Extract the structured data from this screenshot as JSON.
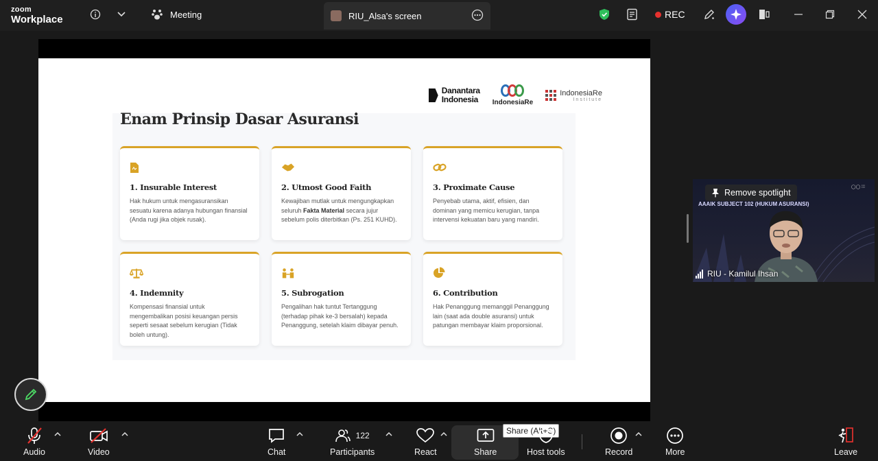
{
  "topbar": {
    "brand_top": "zoom",
    "brand_bottom": "Workplace",
    "meeting_tab": "Meeting",
    "screen_tab": "RIU_Alsa's screen",
    "rec_label": "REC",
    "icons": [
      "info-icon",
      "chevron-down-icon",
      "meeting-icon",
      "more-icon",
      "shield-icon",
      "notes-icon",
      "annotate-icon",
      "ai-companion-icon",
      "layout-icon",
      "minimize-icon",
      "maximize-icon",
      "close-icon"
    ]
  },
  "slide": {
    "title": "Enam Prinsip Dasar Asuransi",
    "logos": {
      "danantara_line1": "Danantara",
      "danantara_line2": "Indonesia",
      "indonesiare": "IndonesiaRe",
      "institute_main": "IndonesiaRe",
      "institute_sub": "Institute"
    },
    "cards": [
      {
        "title": "1. Insurable Interest",
        "icon": "document-icon",
        "text": "Hak hukum untuk mengasuransikan sesuatu karena adanya hubungan finansial (Anda rugi jika objek rusak).",
        "bold": ""
      },
      {
        "title": "2. Utmost Good Faith",
        "icon": "handshake-icon",
        "text_pre": "Kewajiban mutlak untuk mengungkapkan seluruh ",
        "bold": "Fakta Material",
        "text_post": " secara jujur sebelum polis diterbitkan (Ps. 251 KUHD)."
      },
      {
        "title": "3. Proximate Cause",
        "icon": "link-icon",
        "text": "Penyebab utama, aktif, efisien, dan dominan yang memicu kerugian, tanpa intervensi kekuatan baru yang mandiri.",
        "bold": ""
      },
      {
        "title": "4. Indemnity",
        "icon": "scale-icon",
        "text": "Kompensasi finansial untuk mengembalikan posisi keuangan persis seperti sesaat sebelum kerugian (Tidak boleh untung).",
        "bold": ""
      },
      {
        "title": "5. Subrogation",
        "icon": "people-icon",
        "text": "Pengalihan hak tuntut Tertanggung (terhadap pihak ke-3 bersalah) kepada Penanggung, setelah klaim dibayar penuh.",
        "bold": ""
      },
      {
        "title": "6. Contribution",
        "icon": "pie-icon",
        "text": "Hak Penanggung memanggil Penanggung lain (saat ada double asuransi) untuk patungan membayar klaim proporsional.",
        "bold": ""
      }
    ]
  },
  "video": {
    "spotlight_label": "Remove spotlight",
    "subject_text": "AAAIK SUBJECT 102 (HUKUM ASURANSI)",
    "participant_name": "RIU - Kamilul Ihsan"
  },
  "toolbar": {
    "audio": "Audio",
    "video": "Video",
    "chat": "Chat",
    "participants": "Participants",
    "participants_count": "122",
    "react": "React",
    "share": "Share",
    "share_tooltip": "Share (Alt+S)",
    "host_tools": "Host tools",
    "record": "Record",
    "more": "More",
    "leave": "Leave"
  },
  "colors": {
    "accent_gold": "#d9a326",
    "rec_red": "#e5312e",
    "mute_red": "#e5312e",
    "shield_green": "#2fbf5b"
  }
}
